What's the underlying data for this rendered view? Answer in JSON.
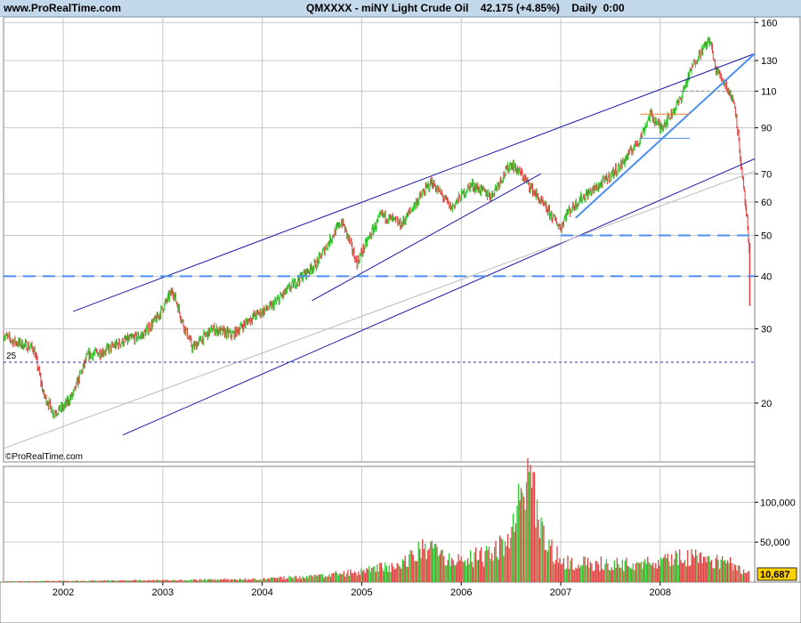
{
  "header": {
    "site": "www.ProRealTime.com",
    "symbol": "QMXXXX",
    "name": "miNY Light Crude Oil",
    "last": "42.175",
    "change": "(+4.85%)",
    "period": "Daily",
    "time": "0:00"
  },
  "watermark": "©ProRealTime.com",
  "colors": {
    "up": "#2ecc2e",
    "down": "#e04040",
    "trend": "#1a1aa8",
    "support": "#4d8ff0",
    "grid": "#c8c8c8",
    "header_bg": "#c4d8ec",
    "last_value_box": "#ffd000"
  },
  "price_axis": {
    "ticks": [
      "160",
      "130",
      "110",
      "90",
      "70",
      "60",
      "50",
      "40",
      "30",
      "20"
    ]
  },
  "volume_axis": {
    "ticks": [
      "100,000",
      "50,000"
    ],
    "last_value": "10,687"
  },
  "x_axis": {
    "ticks": [
      "2002",
      "2003",
      "2004",
      "2005",
      "2006",
      "2007",
      "2008"
    ]
  },
  "level_label": "25",
  "chart_data": [
    {
      "type": "line",
      "title": "QMXXXX - miNY Light Crude Oil",
      "scale": "log",
      "ylim": [
        14.5,
        165
      ],
      "xlim": [
        2001.4,
        2008.95
      ],
      "x": [
        2001.4,
        2001.5,
        2001.6,
        2001.7,
        2001.8,
        2001.9,
        2002.0,
        2002.1,
        2002.25,
        2002.4,
        2002.6,
        2002.8,
        2002.95,
        2003.1,
        2003.2,
        2003.3,
        2003.5,
        2003.7,
        2003.9,
        2004.1,
        2004.3,
        2004.4,
        2004.55,
        2004.8,
        2004.95,
        2005.2,
        2005.4,
        2005.55,
        2005.7,
        2005.9,
        2006.1,
        2006.3,
        2006.5,
        2006.6,
        2006.8,
        2007.0,
        2007.05,
        2007.2,
        2007.4,
        2007.6,
        2007.8,
        2007.9,
        2008.0,
        2008.1,
        2008.2,
        2008.35,
        2008.5,
        2008.55,
        2008.65,
        2008.75,
        2008.82,
        2008.87,
        2008.9
      ],
      "y": [
        29,
        28,
        27.5,
        27,
        21,
        19,
        19.5,
        21,
        26,
        26.5,
        28,
        29,
        32,
        37,
        31,
        27,
        30,
        29,
        32,
        34,
        38,
        40,
        43,
        54,
        43,
        56,
        53,
        60,
        67,
        58,
        66,
        62,
        74,
        70,
        60,
        52,
        56,
        61,
        66,
        73,
        85,
        97,
        90,
        96,
        105,
        130,
        146,
        125,
        115,
        102,
        70,
        55,
        42
      ],
      "annotations": {
        "last": 42.175,
        "horizontal_levels": [
          25,
          40,
          50,
          110
        ]
      }
    },
    {
      "type": "bar",
      "title": "Volume",
      "xlim": [
        2001.4,
        2008.95
      ],
      "ylim": [
        0,
        145000
      ],
      "x": [
        2001.4,
        2002.0,
        2003.0,
        2004.0,
        2004.5,
        2005.0,
        2005.4,
        2005.6,
        2005.8,
        2006.0,
        2006.3,
        2006.5,
        2006.6,
        2006.7,
        2006.8,
        2007.0,
        2007.3,
        2007.6,
        2008.0,
        2008.3,
        2008.5,
        2008.7,
        2008.9
      ],
      "values": [
        1000,
        1500,
        2500,
        4000,
        8000,
        14000,
        25000,
        42000,
        38000,
        32000,
        36000,
        62000,
        110000,
        125000,
        62000,
        28000,
        25000,
        24000,
        28000,
        36000,
        30000,
        25000,
        10687
      ]
    }
  ]
}
